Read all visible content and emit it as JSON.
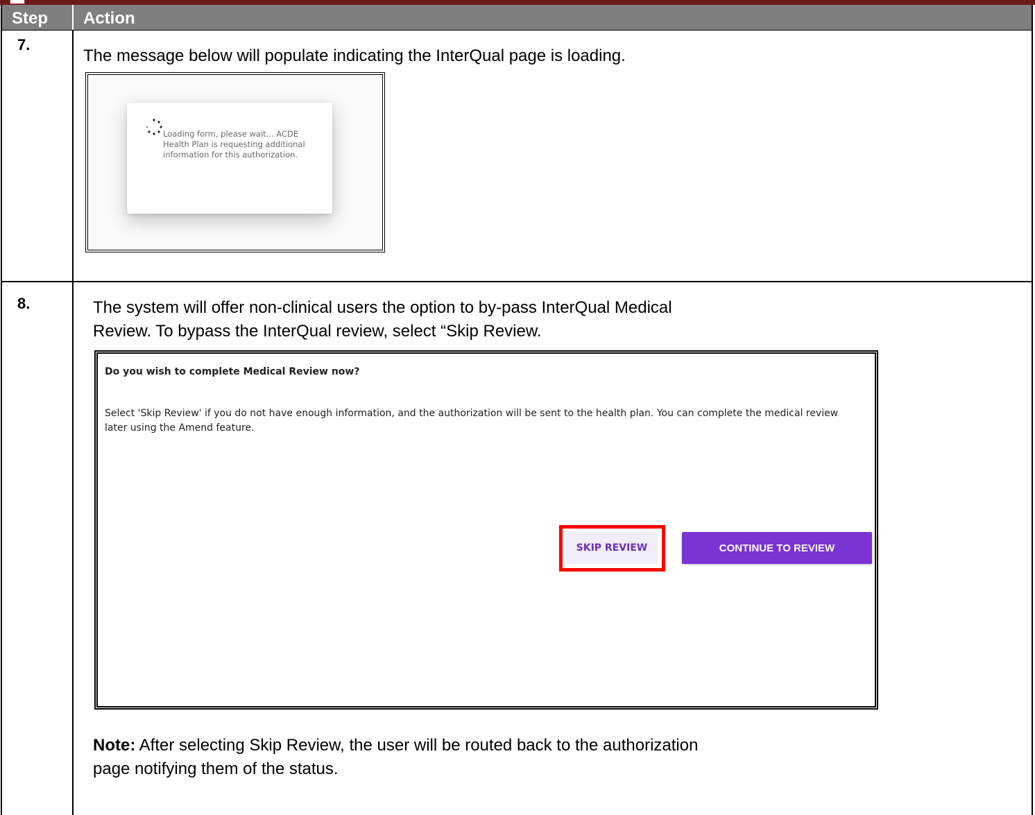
{
  "table": {
    "header": {
      "step": "Step",
      "action": "Action"
    },
    "rows": [
      {
        "step": "7.",
        "text": "The message below will populate indicating the InterQual page is loading.",
        "loading_message": "Loading form, please wait... ACDE Health Plan is requesting additional information for this authorization."
      },
      {
        "step": "8.",
        "text_line1": "The system will offer non-clinical users the option to by-pass InterQual Medical",
        "text_line2": "Review. To bypass the InterQual review, select “Skip Review.",
        "dialog": {
          "title": "Do you wish to complete Medical Review now?",
          "body": "Select 'Skip Review' if you do not have enough information, and the authorization will be sent to the health plan. You can complete the medical review later using the Amend feature.",
          "skip_label": "SKIP REVIEW",
          "continue_label": "CONTINUE TO REVIEW",
          "accent_color": "#7b33d4",
          "highlight_color": "#ff0000"
        },
        "note_label": "Note:",
        "note_line1": " After selecting Skip Review, the user will be routed back to the authorization",
        "note_line2": "page notifying them of the status."
      }
    ]
  }
}
